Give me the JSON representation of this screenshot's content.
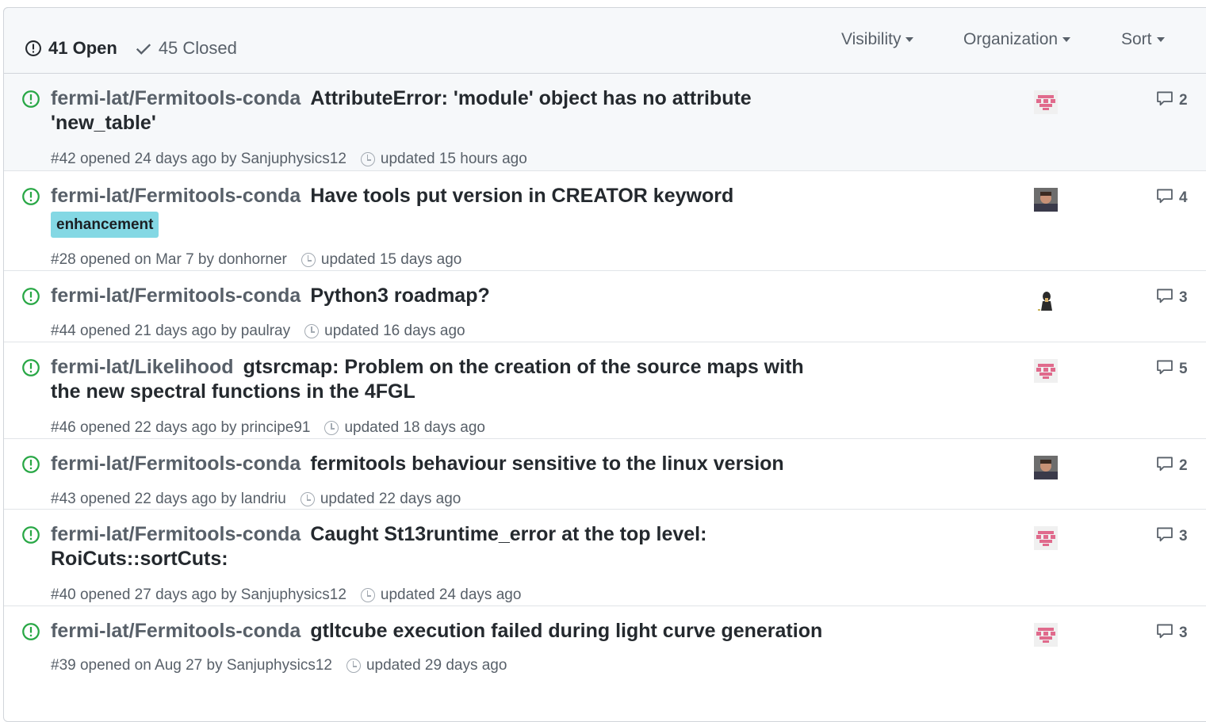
{
  "header": {
    "open_label": "41 Open",
    "closed_label": "45 Closed",
    "filters": [
      "Visibility",
      "Organization",
      "Sort"
    ]
  },
  "issues": [
    {
      "repo": "fermi-lat/Fermitools-conda",
      "title_line1": "AttributeError: 'module' object has no attribute",
      "title_line2": "'new_table'",
      "label": "",
      "meta_opened": "#42 opened 24 days ago by Sanjuphysics12",
      "meta_updated": "updated 15 hours ago",
      "comments": "2",
      "avatar": "pink-identicon"
    },
    {
      "repo": "fermi-lat/Fermitools-conda",
      "title_line1": "Have tools put version in CREATOR keyword",
      "title_line2": "",
      "label": "enhancement",
      "meta_opened": "#28 opened on Mar 7 by donhorner",
      "meta_updated": "updated 15 days ago",
      "comments": "4",
      "avatar": "person-photo"
    },
    {
      "repo": "fermi-lat/Fermitools-conda",
      "title_line1": "Python3 roadmap?",
      "title_line2": "",
      "label": "",
      "meta_opened": "#44 opened 21 days ago by paulray",
      "meta_updated": "updated 16 days ago",
      "comments": "3",
      "avatar": "person-dark"
    },
    {
      "repo": "fermi-lat/Likelihood",
      "title_line1": "gtsrcmap: Problem on the creation of the source maps with",
      "title_line2": "the new spectral functions in the 4FGL",
      "label": "",
      "meta_opened": "#46 opened 22 days ago by principe91",
      "meta_updated": "updated 18 days ago",
      "comments": "5",
      "avatar": "pink-identicon"
    },
    {
      "repo": "fermi-lat/Fermitools-conda",
      "title_line1": "fermitools behaviour sensitive to the linux version",
      "title_line2": "",
      "label": "",
      "meta_opened": "#43 opened 22 days ago by landriu",
      "meta_updated": "updated 22 days ago",
      "comments": "2",
      "avatar": "person-photo"
    },
    {
      "repo": "fermi-lat/Fermitools-conda",
      "title_line1": "Caught St13runtime_error at the top level:",
      "title_line2": "RoiCuts::sortCuts:",
      "label": "",
      "meta_opened": "#40 opened 27 days ago by Sanjuphysics12",
      "meta_updated": "updated 24 days ago",
      "comments": "3",
      "avatar": "pink-identicon"
    },
    {
      "repo": "fermi-lat/Fermitools-conda",
      "title_line1": "gtltcube execution failed during light curve generation",
      "title_line2": "",
      "label": "",
      "meta_opened": "#39 opened on Aug 27 by Sanjuphysics12",
      "meta_updated": "updated 29 days ago",
      "comments": "3",
      "avatar": "pink-identicon"
    }
  ],
  "colors": {
    "open_green": "#28a745",
    "label_bg": "#84d8e4",
    "muted": "#586069",
    "header_bg": "#f6f8fa"
  }
}
